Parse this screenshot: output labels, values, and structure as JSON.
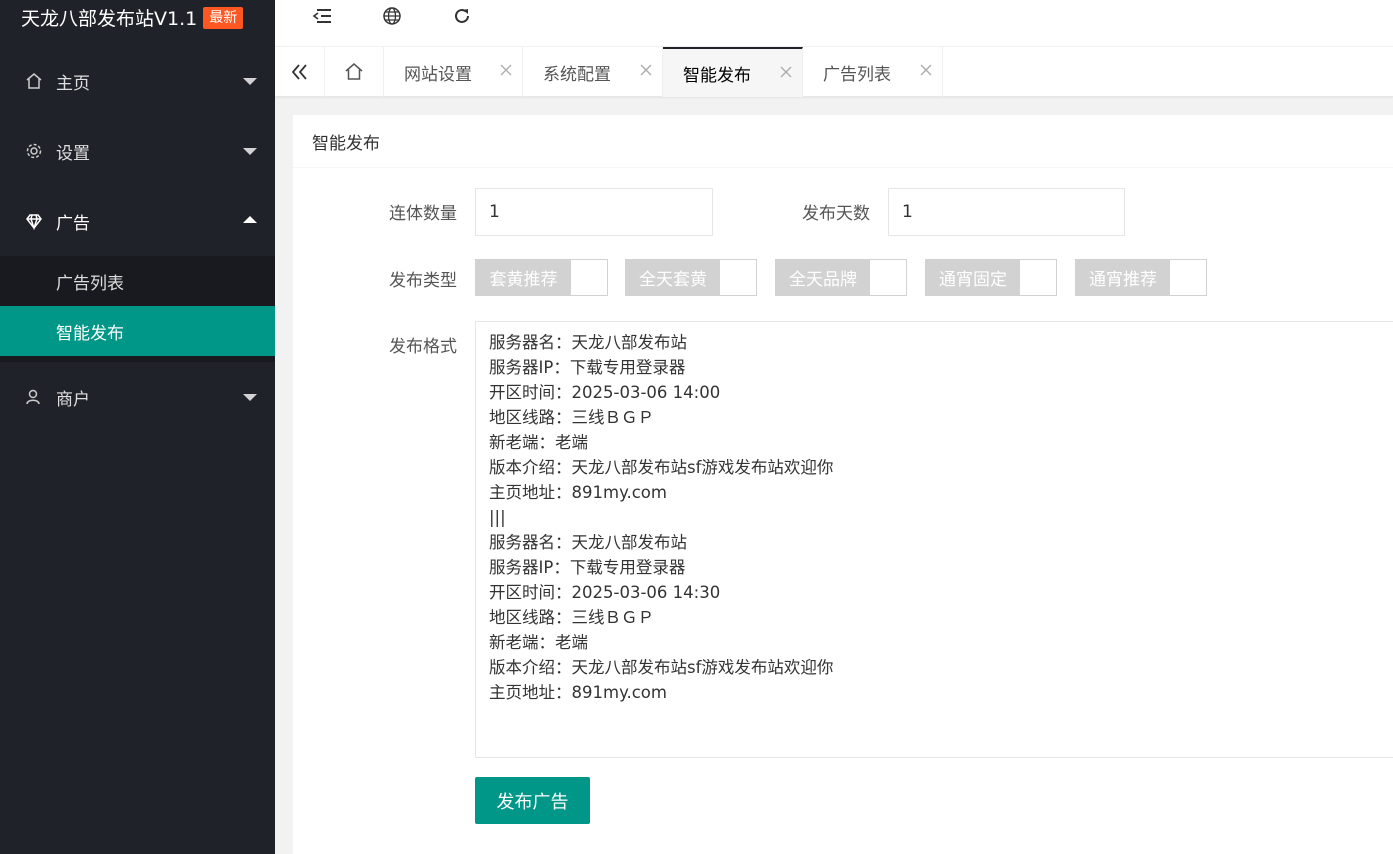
{
  "app": {
    "title": "天龙八部发布站V1.1",
    "badge": "最新"
  },
  "sidebar": {
    "items": [
      {
        "label": "主页",
        "icon": "home-icon"
      },
      {
        "label": "设置",
        "icon": "gear-icon"
      },
      {
        "label": "广告",
        "icon": "diamond-icon"
      },
      {
        "label": "商户",
        "icon": "user-icon"
      }
    ],
    "sub_items": [
      {
        "label": "广告列表"
      },
      {
        "label": "智能发布"
      }
    ]
  },
  "header": {
    "icons": [
      "menu-toggle-icon",
      "globe-icon",
      "refresh-icon"
    ]
  },
  "tabs": {
    "items": [
      {
        "label": "网站设置"
      },
      {
        "label": "系统配置"
      },
      {
        "label": "智能发布"
      },
      {
        "label": "广告列表"
      }
    ],
    "active": "智能发布"
  },
  "card": {
    "title": "智能发布",
    "fields": {
      "count_label": "连体数量",
      "count_value": "1",
      "days_label": "发布天数",
      "days_value": "1",
      "type_label": "发布类型",
      "format_label": "发布格式"
    },
    "types": [
      "套黄推荐",
      "全天套黄",
      "全天品牌",
      "通宵固定",
      "通宵推荐"
    ],
    "format_lines": [
      "服务器名：天龙八部发布站",
      "服务器IP：下载专用登录器",
      "开区时间：2025-03-06 14:00",
      "地区线路：三线ＢＧＰ",
      "新老端：老端",
      "版本介绍：天龙八部发布站sf游戏发布站欢迎你",
      "主页地址：891my.com",
      "|||",
      "服务器名：天龙八部发布站",
      "服务器IP：下载专用登录器",
      "开区时间：2025-03-06 14:30",
      "地区线路：三线ＢＧＰ",
      "新老端：老端",
      "版本介绍：天龙八部发布站sf游戏发布站欢迎你",
      "主页地址：891my.com"
    ],
    "submit_label": "发布广告"
  },
  "colors": {
    "sidebar_bg": "#20222a",
    "accent": "#009688",
    "badge": "#ff5722"
  }
}
